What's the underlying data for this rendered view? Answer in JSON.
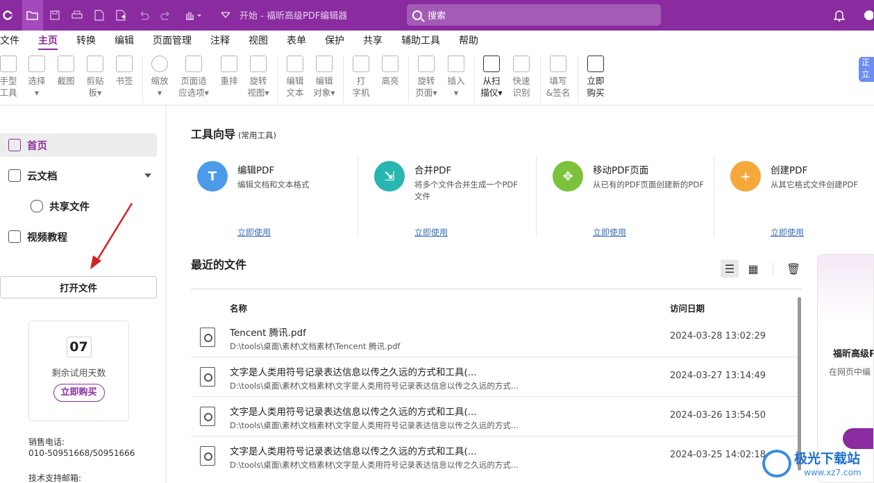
{
  "titlebar": {
    "title": "开始 - 福昕高级PDF编辑器",
    "search_placeholder": "搜索"
  },
  "menu": [
    "文件",
    "主页",
    "转换",
    "编辑",
    "页面管理",
    "注释",
    "视图",
    "表单",
    "保护",
    "共享",
    "辅助工具",
    "帮助"
  ],
  "ribbon": {
    "items": [
      {
        "l1": "手型",
        "l2": "工具"
      },
      {
        "l1": "选择",
        "l2": "▾"
      },
      {
        "l1": "截图",
        "l2": ""
      },
      {
        "l1": "剪贴",
        "l2": "板▾"
      },
      {
        "l1": "书签",
        "l2": ""
      },
      {
        "l1": "缩放",
        "l2": "▾"
      },
      {
        "l1": "页面适",
        "l2": "应选项▾"
      },
      {
        "l1": "重排",
        "l2": ""
      },
      {
        "l1": "旋转",
        "l2": "视图▾"
      },
      {
        "l1": "编辑",
        "l2": "文本"
      },
      {
        "l1": "编辑",
        "l2": "对象▾"
      },
      {
        "l1": "打",
        "l2": "字机"
      },
      {
        "l1": "高亮",
        "l2": ""
      },
      {
        "l1": "旋转",
        "l2": "页面▾"
      },
      {
        "l1": "插入",
        "l2": "▾"
      },
      {
        "l1": "从扫",
        "l2": "描仪▾"
      },
      {
        "l1": "快速",
        "l2": "识别"
      },
      {
        "l1": "填写",
        "l2": "&签名"
      },
      {
        "l1": "立即",
        "l2": "购买"
      }
    ],
    "right_tag": "正立"
  },
  "sidebar": {
    "home": "首页",
    "cloud": "云文档",
    "shared": "共享文件",
    "video": "视频教程",
    "open_file": "打开文件",
    "trial_days": "07",
    "trial_label": "剩余试用天数",
    "buy_now": "立即购买",
    "sales_label": "销售电话:",
    "sales_phone": "010-50951668/50951666",
    "support_label": "技术支持邮箱:"
  },
  "tools": {
    "title": "工具向导",
    "subtitle": "(常用工具)",
    "items": [
      {
        "name": "编辑PDF",
        "desc": "编辑文档和文本格式",
        "link": "立即使用",
        "color": "#4c9be8"
      },
      {
        "name": "合并PDF",
        "desc": "将多个文件合并生成一个PDF文件",
        "link": "立即使用",
        "color": "#28b6b0"
      },
      {
        "name": "移动PDF页面",
        "desc": "从已有的PDF页面创建新的PDF",
        "link": "立即使用",
        "color": "#7cc23b"
      },
      {
        "name": "创建PDF",
        "desc": "从其它格式文件创建PDF",
        "link": "立即使用",
        "color": "#f5a93a"
      }
    ]
  },
  "recent": {
    "title": "最近的文件",
    "col_name": "名称",
    "col_date": "访问日期",
    "rows": [
      {
        "name": "Tencent 腾讯.pdf",
        "path": "D:\\tools\\桌面\\素材\\文档素材\\Tencent 腾讯.pdf",
        "date": "2024-03-28 13:02:29"
      },
      {
        "name": "文字是人类用符号记录表达信息以传之久远的方式和工具(...",
        "path": "D:\\tools\\桌面\\素材\\文档素材\\文字是人类用符号记录表达信息以传之久远的方式...",
        "date": "2024-03-27 13:14:49"
      },
      {
        "name": "文字是人类用符号记录表达信息以传之久远的方式和工具(...",
        "path": "D:\\tools\\桌面\\素材\\文档素材\\文字是人类用符号记录表达信息以传之久远的方式...",
        "date": "2024-03-26 13:54:50"
      },
      {
        "name": "文字是人类用符号记录表达信息以传之久远的方式和工具(...",
        "path": "D:\\tools\\桌面\\素材\\文档素材\\文字是人类用符号记录表达信息以传之久远的方式...",
        "date": "2024-03-25 14:02:18"
      }
    ]
  },
  "promo": {
    "title": "福昕高级P",
    "desc": "在网页中编"
  },
  "watermark": {
    "name": "极光下载站",
    "url": "www.xz7.com"
  }
}
